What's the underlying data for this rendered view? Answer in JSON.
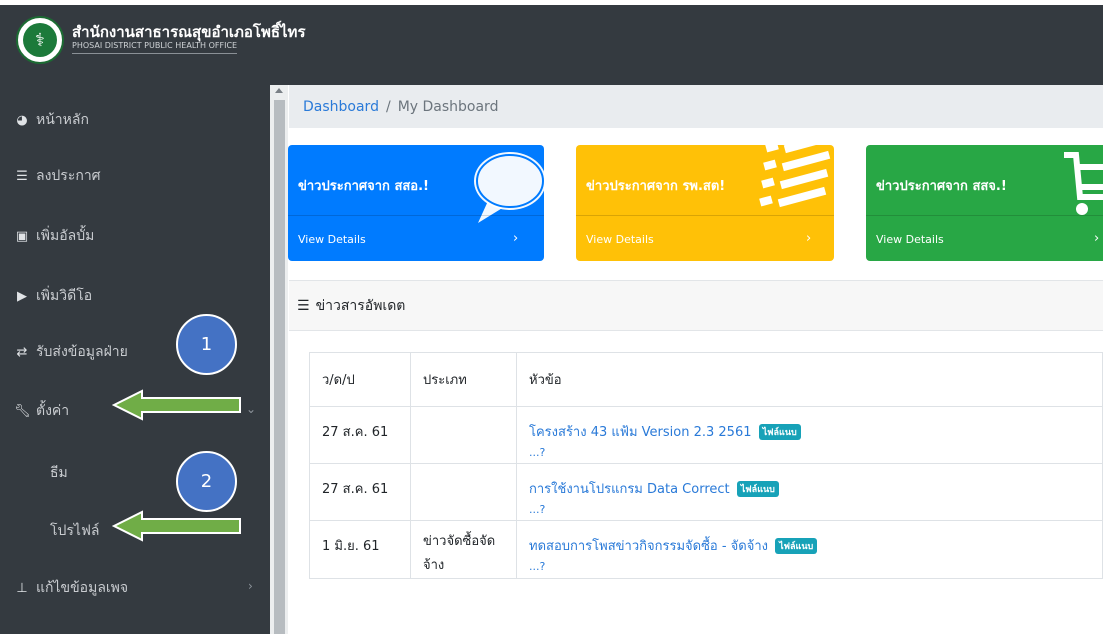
{
  "brand": {
    "title": "สำนักงานสาธารณสุขอำเภอโพธิ์ไทร",
    "subtitle": "PHOSAI DISTRICT PUBLIC HEALTH OFFICE",
    "logo_icon": "health-office-seal-icon"
  },
  "sidebar": {
    "items": [
      {
        "label": "หน้าหลัก",
        "icon": "dashboard-icon"
      },
      {
        "label": "ลงประกาศ",
        "icon": "list-icon"
      },
      {
        "label": "เพิ่มอัลบั้ม",
        "icon": "image-icon"
      },
      {
        "label": "เพิ่มวิดีโอ",
        "icon": "video-icon"
      },
      {
        "label": "รับส่งข้อมูลฝ่าย",
        "icon": "exchange-icon"
      },
      {
        "label": "ตั้งค่า",
        "icon": "wrench-icon"
      },
      {
        "label": "ธีม"
      },
      {
        "label": "โปรไฟล์"
      },
      {
        "label": "แก้ไขข้อมูลเพจ",
        "icon": "sitemap-icon"
      }
    ]
  },
  "breadcrumb": {
    "root": "Dashboard",
    "separator": "/",
    "current": "My Dashboard"
  },
  "cards": [
    {
      "title": "ข่าวประกาศจาก สสอ.!",
      "footer": "View Details",
      "arrow": "›",
      "color": "#007bff",
      "icon": "comment-icon"
    },
    {
      "title": "ข่าวประกาศจาก รพ.สต!",
      "footer": "View Details",
      "arrow": "›",
      "color": "#ffc107",
      "icon": "list-icon"
    },
    {
      "title": "ข่าวประกาศจาก สสจ.!",
      "footer": "View Details",
      "arrow": "›",
      "color": "#28a745",
      "icon": "shopping-cart-icon"
    }
  ],
  "news": {
    "header": "ข่าวสารอัพเดต",
    "columns": [
      "ว/ด/ป",
      "ประเภท",
      "หัวข้อ"
    ],
    "rows": [
      {
        "date": "27 ส.ค. 61",
        "type": "",
        "title": "โครงสร้าง 43 แฟ้ม Version 2.3 2561",
        "badge": "ไฟล์แนบ",
        "more": "...?"
      },
      {
        "date": "27 ส.ค. 61",
        "type": "",
        "title": "การใช้งานโปรแกรม Data Correct",
        "badge": "ไฟล์แนบ",
        "more": "...?"
      },
      {
        "date": "1 มิ.ย. 61",
        "type": "ข่าวจัดซื้อจัดจ้าง",
        "title": "ทดสอบการโพสข่าวกิจกรรมจัดซื้อ - จัดจ้าง",
        "badge": "ไฟล์แนบ",
        "more": "...?"
      }
    ]
  },
  "annotations": [
    {
      "label": "1",
      "color": "#4472c4"
    },
    {
      "label": "2",
      "color": "#4472c4"
    }
  ],
  "colors": {
    "sidebar": "#343a40",
    "link": "#2a7ad8",
    "badge": "#17a2b8",
    "annotation_arrow": "#70ad47"
  }
}
